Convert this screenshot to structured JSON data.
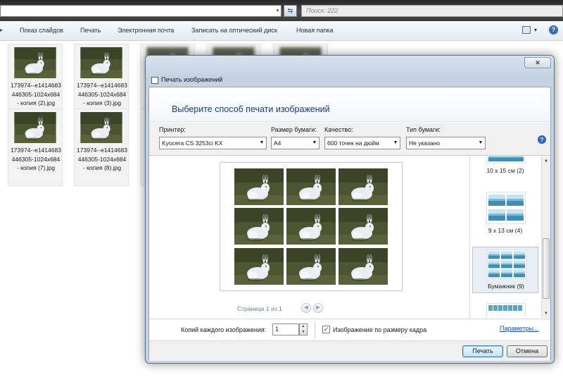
{
  "explorer": {
    "search_placeholder": "Поиск: 222",
    "address_drop": "▾",
    "address_go": "⇆",
    "toolbar": {
      "items": [
        "Показ слайдов",
        "Печать",
        "Электронная почта",
        "Записать на оптический диск",
        "Новая папка"
      ],
      "help": "?",
      "view_drop": "▾"
    },
    "files": [
      {
        "name": "173974--e1414683446305-1024x684 - копия (2).jpg",
        "line1": "173974--e1414683",
        "line2": "446305-1024x684",
        "line3": "- копия (2).jpg"
      },
      {
        "name": "173974--e1414683446305-1024x684 - копия (3).jpg",
        "line1": "173974--e1414683",
        "line2": "446305-1024x684",
        "line3": "- копия (3).jpg"
      },
      {
        "name": "173974--e1414683446305-1024x684 - копия (7).jpg",
        "line1": "173974--e1414683",
        "line2": "446305-1024x684",
        "line3": "- копия (7).jpg"
      },
      {
        "name": "173974--e1414683446305-1024x684 - копия (8).jpg",
        "line1": "173974--e1414683",
        "line2": "446305-1024x684",
        "line3": "- копия (8).jpg"
      }
    ]
  },
  "dialog": {
    "title": "Печать изображений",
    "close": "✕",
    "heading": "Выберите способ печати изображений",
    "help": "?",
    "printer": {
      "label": "Принтер:",
      "value": "Kyocera CS 3253ci KX"
    },
    "paper_size": {
      "label": "Размер бумаги:",
      "value": "A4"
    },
    "quality": {
      "label": "Качество:",
      "value": "600 точек на дюйм"
    },
    "paper_type": {
      "label": "Тип бумаги:",
      "value": "Не указано"
    },
    "preview": {
      "page_info": "Страница 1 из 1",
      "photos_per_page": 9,
      "prev": "◀",
      "next": "▶"
    },
    "layouts": [
      {
        "label": "10 x 15 см (2)",
        "selected": false
      },
      {
        "label": "9 x 13 см (4)",
        "selected": false
      },
      {
        "label": "Бумажник (9)",
        "selected": true
      }
    ],
    "scroll": {
      "up": "▲",
      "down": "▼"
    },
    "copies": {
      "label": "Копий каждого изображения:",
      "value": "1",
      "spin_up": "▲",
      "spin_down": "▼"
    },
    "fit": {
      "label": "Изображение по размеру кадра",
      "checked": true,
      "mark": "✓"
    },
    "params_link": "Параметры...",
    "print_button": "Печать",
    "cancel_button": "Отмена"
  },
  "colors": {
    "accent": "#1e3a6e",
    "link": "#1f4ea0",
    "grass": "#4b5532"
  }
}
